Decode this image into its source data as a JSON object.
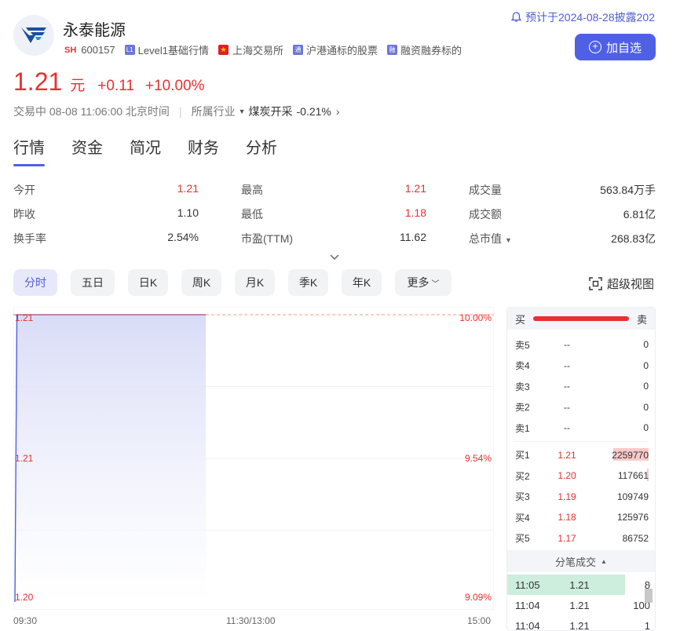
{
  "stock": {
    "name": "永泰能源",
    "market": "SH",
    "code": "600157",
    "tags": [
      "Level1基础行情",
      "上海交易所",
      "沪港通标的股票",
      "融资融券标的"
    ],
    "tag_badges": [
      "L1",
      "",
      "通",
      "融"
    ]
  },
  "notice": "预计于2024-08-28披露202",
  "watch_button": "加自选",
  "quote": {
    "price": "1.21",
    "unit": "元",
    "change": "+0.11",
    "change_pct": "+10.00%",
    "status": "交易中 08-08 11:06:00 北京时间",
    "industry_label": "所属行业",
    "industry": "煤炭开采",
    "industry_change": "-0.21%"
  },
  "tabs": [
    "行情",
    "资金",
    "简况",
    "财务",
    "分析"
  ],
  "stats": [
    [
      {
        "label": "今开",
        "value": "1.21",
        "red": true
      },
      {
        "label": "最高",
        "value": "1.21",
        "red": true
      },
      {
        "label": "成交量",
        "value": "563.84万手",
        "red": false
      }
    ],
    [
      {
        "label": "昨收",
        "value": "1.10",
        "red": false
      },
      {
        "label": "最低",
        "value": "1.18",
        "red": true
      },
      {
        "label": "成交额",
        "value": "6.81亿",
        "red": false
      }
    ],
    [
      {
        "label": "换手率",
        "value": "2.54%",
        "red": false
      },
      {
        "label": "市盈(TTM)",
        "value": "11.62",
        "red": false
      },
      {
        "label": "总市值",
        "value": "268.83亿",
        "red": false
      }
    ]
  ],
  "periods": [
    "分时",
    "五日",
    "日K",
    "周K",
    "月K",
    "季K",
    "年K",
    "更多"
  ],
  "super_view": "超级视图",
  "chart_data": {
    "type": "line",
    "y_left_labels": [
      "1.21",
      "1.21",
      "1.20"
    ],
    "y_right_labels": [
      "10.00%",
      "9.54%",
      "9.09%"
    ],
    "x_labels": [
      "09:30",
      "11:30/13:00",
      "15:00"
    ],
    "ylim": [
      1.2,
      1.21
    ],
    "prev_close": 1.1,
    "x": [
      "09:30",
      "09:31",
      "11:06"
    ],
    "values": [
      1.2,
      1.21,
      1.21
    ]
  },
  "book": {
    "buy_label": "买",
    "sell_label": "卖",
    "asks": [
      {
        "k": "卖5",
        "p": "--",
        "v": "0"
      },
      {
        "k": "卖4",
        "p": "--",
        "v": "0"
      },
      {
        "k": "卖3",
        "p": "--",
        "v": "0"
      },
      {
        "k": "卖2",
        "p": "--",
        "v": "0"
      },
      {
        "k": "卖1",
        "p": "--",
        "v": "0"
      }
    ],
    "bids": [
      {
        "k": "买1",
        "p": "1.21",
        "v": "2259770",
        "fill": 0.58
      },
      {
        "k": "买2",
        "p": "1.20",
        "v": "117661",
        "fill": 0.03
      },
      {
        "k": "买3",
        "p": "1.19",
        "v": "109749",
        "fill": 0.0
      },
      {
        "k": "买4",
        "p": "1.18",
        "v": "125976",
        "fill": 0.0
      },
      {
        "k": "买5",
        "p": "1.17",
        "v": "86752",
        "fill": 0.0
      }
    ],
    "ticks_label": "分笔成交",
    "ticks": [
      {
        "t": "11:05",
        "p": "1.21",
        "v": "8"
      },
      {
        "t": "11:04",
        "p": "1.21",
        "v": "100"
      },
      {
        "t": "11:04",
        "p": "1.21",
        "v": "1"
      }
    ]
  },
  "colors": {
    "accent": "#5060e5",
    "up": "#e93030",
    "fill": "#dfe1f8"
  }
}
